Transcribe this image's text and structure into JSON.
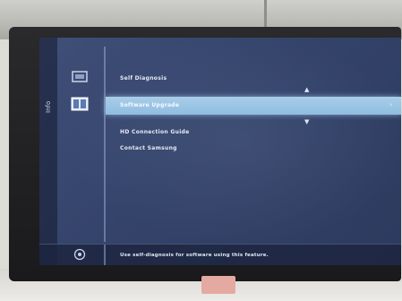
{
  "osd": {
    "side_tab_label": "Info",
    "menu_items": [
      {
        "label": "Self Diagnosis",
        "selected": false
      },
      {
        "label": "Software Upgrade",
        "selected": true
      },
      {
        "label": "HD Connection Guide",
        "selected": false
      },
      {
        "label": "Contact Samsung",
        "selected": false
      }
    ],
    "help_text": "Use self-diagnosis for software using this feature.",
    "accent_color": "#9cc8e8",
    "background_color": "#3a4a72"
  },
  "icons": {
    "top_menu_icon": "monitor-icon",
    "selected_menu_icon": "support-icon",
    "help_icon": "help-icon",
    "scroll_up": "chevron-up-icon",
    "scroll_down": "chevron-down-icon",
    "submenu": "chevron-right-icon"
  }
}
